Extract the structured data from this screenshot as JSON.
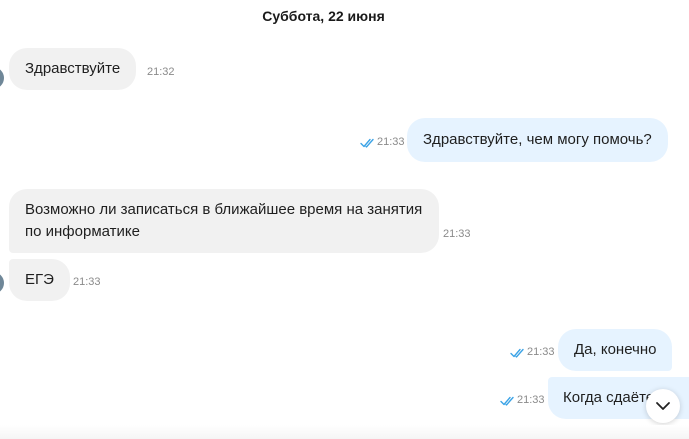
{
  "date_header": "Суббота, 22 июня",
  "messages": [
    {
      "direction": "in",
      "text": "Здравствуйте",
      "time": "21:32"
    },
    {
      "direction": "out",
      "text": "Здравствуйте, чем могу помочь?",
      "time": "21:33",
      "status": "read"
    },
    {
      "direction": "in",
      "text": "Возможно ли записаться в ближайшее время на занятия по информатике",
      "time": "21:33"
    },
    {
      "direction": "in",
      "text": "ЕГЭ",
      "time": "21:33"
    },
    {
      "direction": "out",
      "text": "Да, конечно",
      "time": "21:33",
      "status": "read"
    },
    {
      "direction": "out",
      "text": "Когда сдаёте",
      "time": "21:33",
      "status": "read"
    }
  ],
  "icons": {
    "read_receipt": "double-check-icon",
    "scroll_down": "chevron-down-icon"
  },
  "colors": {
    "incoming_bubble": "#f1f1f1",
    "outgoing_bubble": "#e6f3ff",
    "read_check": "#3ba3e6",
    "timestamp": "#8a8a8a",
    "avatar": "#6f8798"
  }
}
